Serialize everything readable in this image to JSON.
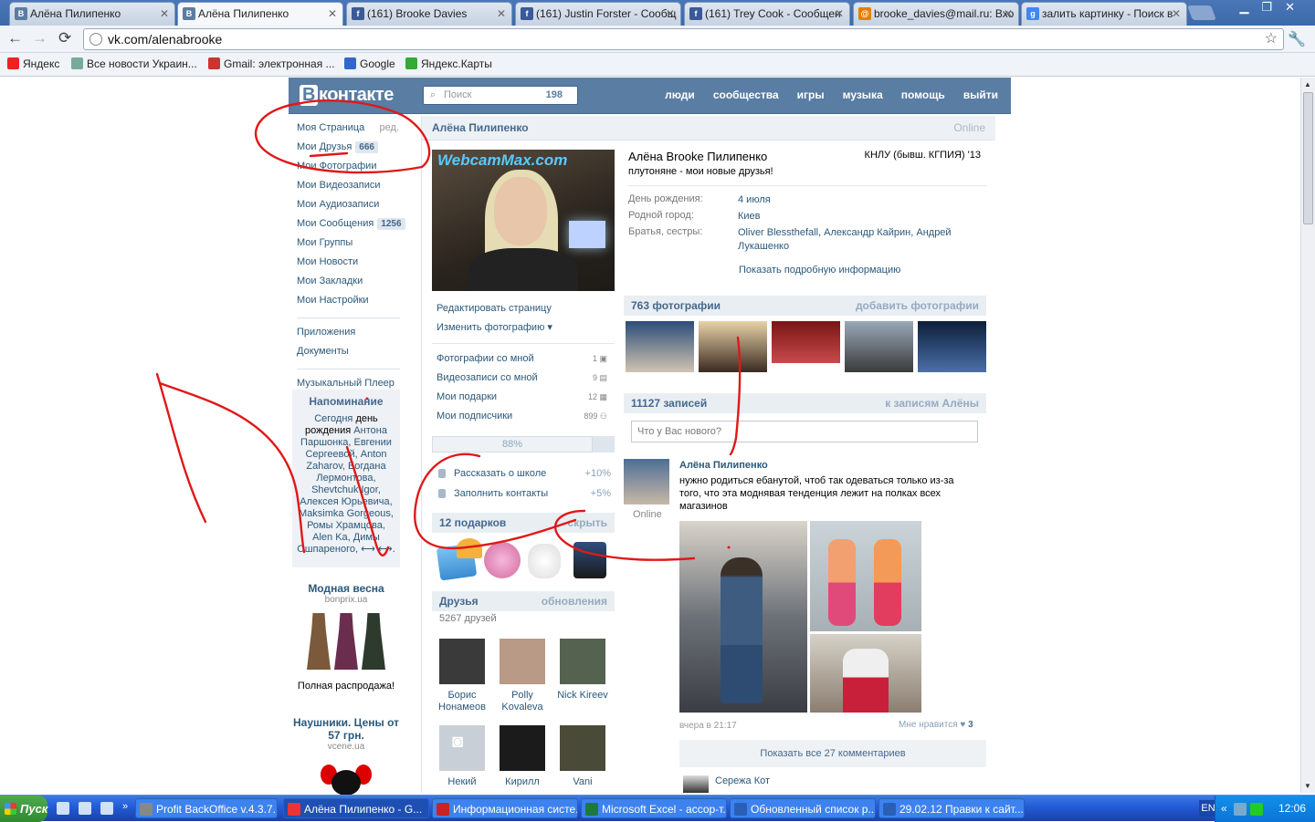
{
  "browser": {
    "tabs": [
      {
        "label": "Алёна Пилипенко",
        "fav": "В",
        "fav_color": "#597da3"
      },
      {
        "label": "Алёна Пилипенко",
        "fav": "В",
        "fav_color": "#597da3",
        "active": true
      },
      {
        "label": "(161) Brooke Davies",
        "fav": "f",
        "fav_color": "#3b5998"
      },
      {
        "label": "(161) Justin Forster - Сообщ",
        "fav": "f",
        "fav_color": "#3b5998"
      },
      {
        "label": "(161) Trey Cook - Сообщен",
        "fav": "f",
        "fav_color": "#3b5998"
      },
      {
        "label": "brooke_davies@mail.ru: Вхо",
        "fav": "@",
        "fav_color": "#e67e00"
      },
      {
        "label": "залить картинку - Поиск в",
        "fav": "g",
        "fav_color": "#4285f4"
      }
    ],
    "url": "vk.com/alenabrooke",
    "bookmarks": [
      {
        "label": "Яндекс",
        "color": "#e22"
      },
      {
        "label": "Все новости Украин...",
        "color": "#7a9"
      },
      {
        "label": "Gmail: электронная ...",
        "color": "#c33"
      },
      {
        "label": "Google",
        "color": "#36c"
      },
      {
        "label": "Яндекс.Карты",
        "color": "#3a3"
      }
    ]
  },
  "vk": {
    "logo_b": "В",
    "logo_text": "контакте",
    "search_placeholder": "Поиск",
    "search_count": "198",
    "nav": [
      "люди",
      "сообщества",
      "игры",
      "музыка",
      "помощь",
      "выйти"
    ],
    "left_menu": [
      {
        "label": "Моя Страница",
        "extra": "ред."
      },
      {
        "label": "Мои Друзья",
        "count": "666"
      },
      {
        "label": "Мои Фотографии"
      },
      {
        "label": "Мои Видеозаписи"
      },
      {
        "label": "Мои Аудиозаписи"
      },
      {
        "label": "Мои Сообщения",
        "count": "1256"
      },
      {
        "label": "Мои Группы"
      },
      {
        "label": "Мои Новости"
      },
      {
        "label": "Мои Закладки"
      },
      {
        "label": "Мои Настройки"
      }
    ],
    "left_menu2": [
      "Приложения",
      "Документы"
    ],
    "left_menu3": [
      "Музыкальный Плеер"
    ],
    "reminder": {
      "title": "Напоминание",
      "lead": "Сегодня",
      "text_a": "день рождения",
      "names": "Антона Паршонка, Евгении Сергеевой, Anton Zaharov, Богдана Лермонтова, Shevtchuk Igor, Алексея Юрьевича, Maksimka Gorgeous, Ромы Храмцова, Alen Ka, Димы Ошпареного, ⟷ ⟷."
    },
    "ads": [
      {
        "title": "Модная весна",
        "domain": "bonprix.ua",
        "caption": "Полная распродажа!"
      },
      {
        "title": "Наушники. Цены от 57 грн.",
        "domain": "vcene.ua"
      }
    ],
    "profile": {
      "name_bar": "Алёна Пилипенко",
      "online": "Online",
      "full_name": "Алёна Brooke Пилипенко",
      "status": "плутоняне - мои новые друзья!",
      "university": "КНЛУ (бывш. КГПИЯ) '13",
      "avatar_watermark": "WebcamMax.com",
      "info": [
        {
          "label": "День рождения:",
          "value": "4 июля"
        },
        {
          "label": "Родной город:",
          "value": "Киев"
        },
        {
          "label": "Братья, сестры:",
          "value": "Oliver Blessthefall, Александр Кайрин, Андрей Лукашенко"
        }
      ],
      "more_info": "Показать подробную информацию"
    },
    "avatar_menu": {
      "edit": "Редактировать страницу",
      "change_photo": "Изменить фотографию ▾",
      "links": [
        {
          "label": "Фотографии со мной",
          "count": "1"
        },
        {
          "label": "Видеозаписи со мной",
          "count": "9"
        },
        {
          "label": "Мои подарки",
          "count": "12"
        },
        {
          "label": "Мои подписчики",
          "count": "899"
        }
      ]
    },
    "progress": {
      "label": "88%",
      "value": 0.88
    },
    "tips": [
      {
        "label": "Рассказать о школе",
        "plus": "+10%"
      },
      {
        "label": "Заполнить контакты",
        "plus": "+5%"
      }
    ],
    "gifts": {
      "title": "12 подарков",
      "action": "скрыть"
    },
    "friends": {
      "title": "Друзья",
      "action": "обновления",
      "count": "5267 друзей",
      "list": [
        {
          "name": "Борис Нонамеов",
          "color": "#3a3a3a"
        },
        {
          "name": "Polly Kovaleva",
          "color": "#b89a86"
        },
        {
          "name": "Nick Kireev",
          "color": "#55624f"
        },
        {
          "name": "Некий",
          "color": "#c8cfd6"
        },
        {
          "name": "Кирилл",
          "color": "#1b1b1b"
        },
        {
          "name": "Vani",
          "color": "#4a4a38"
        }
      ]
    },
    "photos": {
      "title": "763 фотографии",
      "action": "добавить фотографии"
    },
    "wall": {
      "title": "11127 записей",
      "action": "к записям Алёны",
      "placeholder": "Что у Вас нового?",
      "post": {
        "author": "Алёна Пилипенко",
        "author_status": "Online",
        "text": "нужно родиться ебанутой, чтоб так одеваться только из-за того, что эта моднявая тенденция лежит на полках всех магазинов",
        "time": "вчера в 21:17",
        "likes_label": "Мне нравится",
        "likes": "3",
        "show_comments": "Показать все 27 комментариев",
        "commenter": "Сережа Кот"
      }
    }
  },
  "taskbar": {
    "start": "Пуск",
    "items": [
      {
        "label": "Profit BackOffice v.4.3.7...",
        "color": "#888"
      },
      {
        "label": "Алёна Пилипенко - G...",
        "color": "#e33",
        "active": true
      },
      {
        "label": "Информационная систе...",
        "color": "#c22"
      },
      {
        "label": "Microsoft Excel - ассор-т...",
        "color": "#1d7a3a"
      },
      {
        "label": "Обновленный список р...",
        "color": "#2b5fb5"
      },
      {
        "label": "29.02.12 Правки к сайт...",
        "color": "#2b5fb5"
      }
    ],
    "lang": "EN",
    "clock": "12:06"
  }
}
